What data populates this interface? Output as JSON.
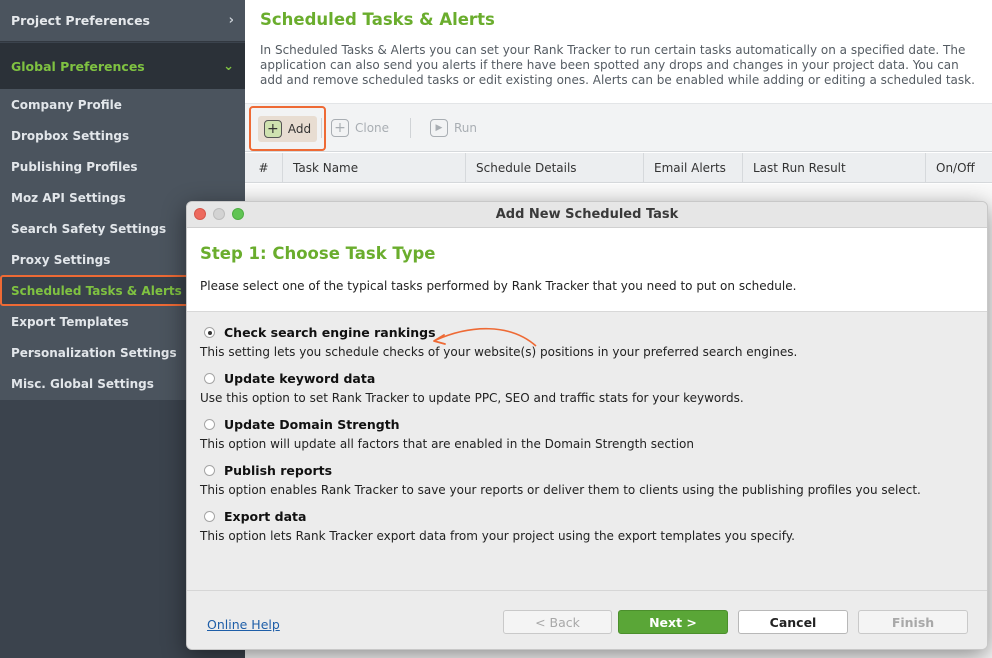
{
  "sidebar": {
    "project_prefs": "Project Preferences",
    "global_prefs": "Global Preferences",
    "items": [
      {
        "label": "Company Profile"
      },
      {
        "label": "Dropbox Settings"
      },
      {
        "label": "Publishing Profiles"
      },
      {
        "label": "Moz API Settings"
      },
      {
        "label": "Search Safety Settings"
      },
      {
        "label": "Proxy Settings"
      },
      {
        "label": "Scheduled Tasks & Alerts"
      },
      {
        "label": "Export Templates"
      },
      {
        "label": "Personalization Settings"
      },
      {
        "label": "Misc. Global Settings"
      }
    ],
    "active_index": 6
  },
  "main": {
    "title": "Scheduled Tasks & Alerts",
    "description": "In Scheduled Tasks & Alerts you can set your Rank Tracker to run certain tasks automatically on a specified date. The application can also send you alerts if there have been spotted any drops and changes in your project data. You can add and remove scheduled tasks or edit existing ones. Alerts can be enabled while adding or editing a scheduled task.",
    "toolbar": {
      "add": "Add",
      "clone": "Clone",
      "run": "Run"
    },
    "columns": [
      "#",
      "Task Name",
      "Schedule Details",
      "Email Alerts",
      "Last Run Result",
      "On/Off"
    ]
  },
  "dialog": {
    "title": "Add New Scheduled Task",
    "step_title": "Step 1: Choose Task Type",
    "step_desc": "Please select one of the typical tasks performed by Rank Tracker that you need to put on schedule.",
    "options": [
      {
        "label": "Check search engine rankings",
        "desc": "This setting lets you schedule checks of your website(s) positions in your preferred search engines.",
        "selected": true
      },
      {
        "label": "Update keyword data",
        "desc": "Use this option to set Rank Tracker to update PPC, SEO and traffic stats for your keywords.",
        "selected": false
      },
      {
        "label": "Update Domain Strength",
        "desc": "This option will update all factors that are enabled in the Domain Strength section",
        "selected": false
      },
      {
        "label": "Publish reports",
        "desc": "This option enables Rank Tracker to save your reports or deliver them to clients using the publishing profiles you select.",
        "selected": false
      },
      {
        "label": "Export data",
        "desc": "This option lets Rank Tracker export data from your project using the export templates you specify.",
        "selected": false
      }
    ],
    "footer": {
      "help": "Online Help",
      "back": "< Back",
      "next": "Next >",
      "cancel": "Cancel",
      "finish": "Finish"
    }
  },
  "colors": {
    "accent_green": "#6aad2d",
    "highlight_orange": "#ee6a35",
    "sidebar_bg": "#4b545e"
  }
}
